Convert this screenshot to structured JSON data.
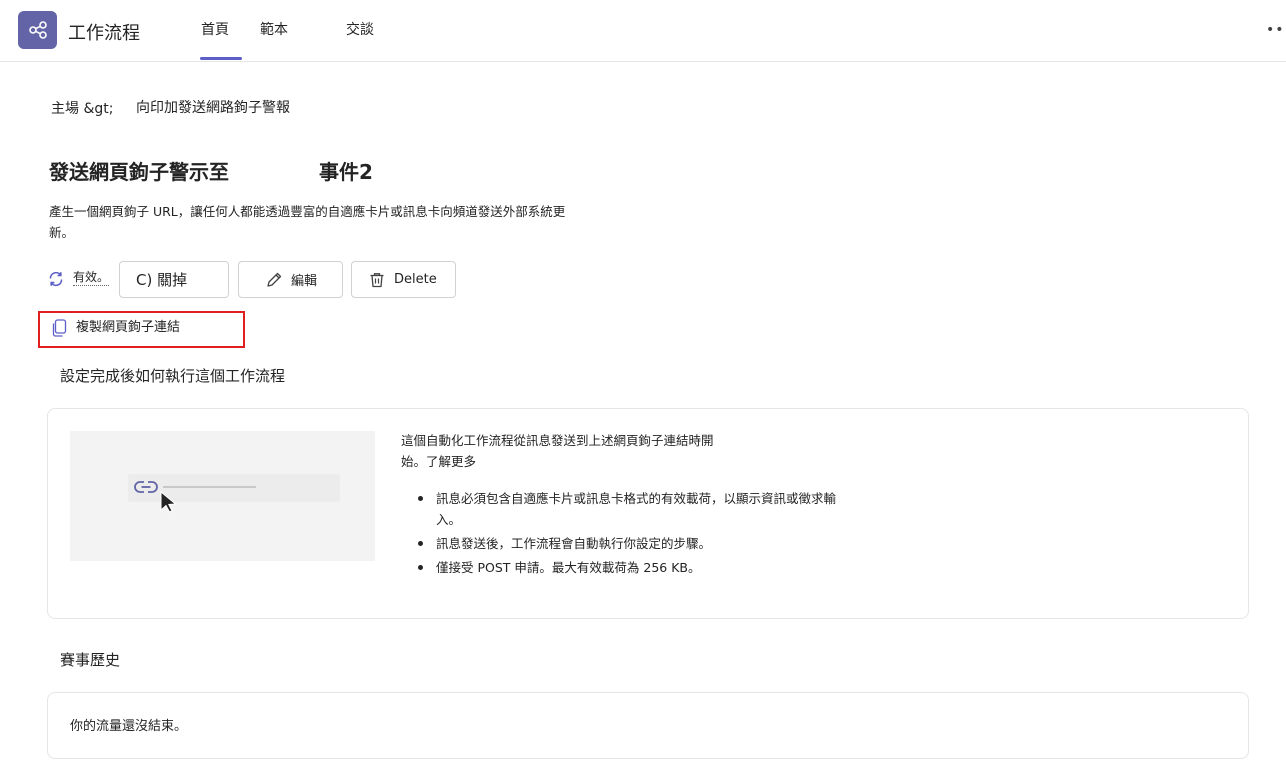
{
  "app": {
    "title": "工作流程",
    "brand_color": "#6264a7",
    "accent_color": "#5b5fc7",
    "icon": "workflow-share-icon"
  },
  "tabs": [
    {
      "label": "首頁",
      "selected": true
    },
    {
      "label": "範本",
      "selected": false
    },
    {
      "label": "交談",
      "selected": false
    }
  ],
  "more_menu": "•••",
  "breadcrumb": {
    "root": "主場 &gt;",
    "current": "向印加發送網路鉤子警報"
  },
  "flow": {
    "title": "發送網頁鉤子警示至",
    "title_suffix": "事件2",
    "description": "產生一個網頁鉤子 URL，讓任何人都能透過豐富的自適應卡片或訊息卡向頻道發送外部系統更新。"
  },
  "actions": {
    "status_label": "有效。",
    "turn_off_label": "C) 關掉",
    "edit_label": "編輯",
    "delete_label": "Delete"
  },
  "copy_link": {
    "label": "複製網頁鉤子連結",
    "highlight_color": "#e02020"
  },
  "how_it_runs": {
    "heading": "設定完成後如何執行這個工作流程",
    "intro": "這個自動化工作流程從訊息發送到上述網頁鉤子連結時開始。了解更多",
    "bullets": [
      "訊息必須包含自適應卡片或訊息卡格式的有效載荷，以顯示資訊或徵求輸入。",
      "訊息發送後，工作流程會自動執行你設定的步驟。",
      "僅接受 POST 申請。最大有效載荷為 256 KB。"
    ]
  },
  "history": {
    "heading": "賽事歷史",
    "empty_text": "你的流量還沒結束。"
  }
}
